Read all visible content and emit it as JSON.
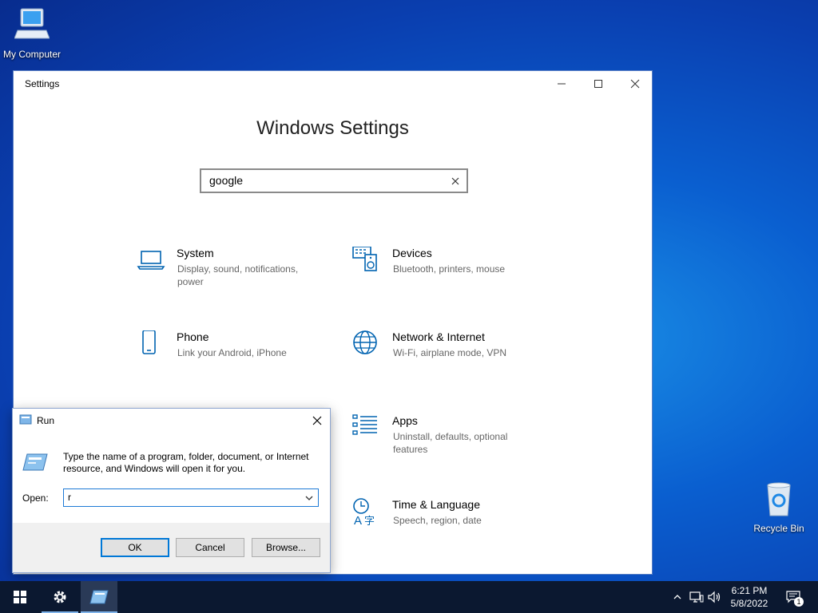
{
  "desktop": {
    "icons": [
      {
        "label": "My Computer"
      },
      {
        "label": "Recycle Bin"
      }
    ]
  },
  "settings_window": {
    "title": "Settings",
    "heading": "Windows Settings",
    "search": {
      "value": "google"
    },
    "tiles": [
      {
        "name": "System",
        "desc": "Display, sound, notifications, power",
        "icon": "laptop-icon"
      },
      {
        "name": "Devices",
        "desc": "Bluetooth, printers, mouse",
        "icon": "devices-icon"
      },
      {
        "name": "Phone",
        "desc": "Link your Android, iPhone",
        "icon": "phone-icon"
      },
      {
        "name": "Network & Internet",
        "desc": "Wi-Fi, airplane mode, VPN",
        "icon": "globe-icon"
      },
      {
        "name": "Apps",
        "desc": "Uninstall, defaults, optional features",
        "icon": "apps-list-icon"
      },
      {
        "name": "Time & Language",
        "desc": "Speech, region, date",
        "icon": "time-language-icon"
      }
    ]
  },
  "run_dialog": {
    "title": "Run",
    "description": "Type the name of a program, folder, document, or Internet resource, and Windows will open it for you.",
    "open_label": "Open:",
    "open_value": "r",
    "buttons": {
      "ok": "OK",
      "cancel": "Cancel",
      "browse": "Browse..."
    }
  },
  "taskbar": {
    "time": "6:21 PM",
    "date": "5/8/2022",
    "notification_count": "1"
  },
  "colors": {
    "accent": "#0078d7",
    "icon_blue": "#0063b1",
    "taskbar": "#0b1830"
  }
}
